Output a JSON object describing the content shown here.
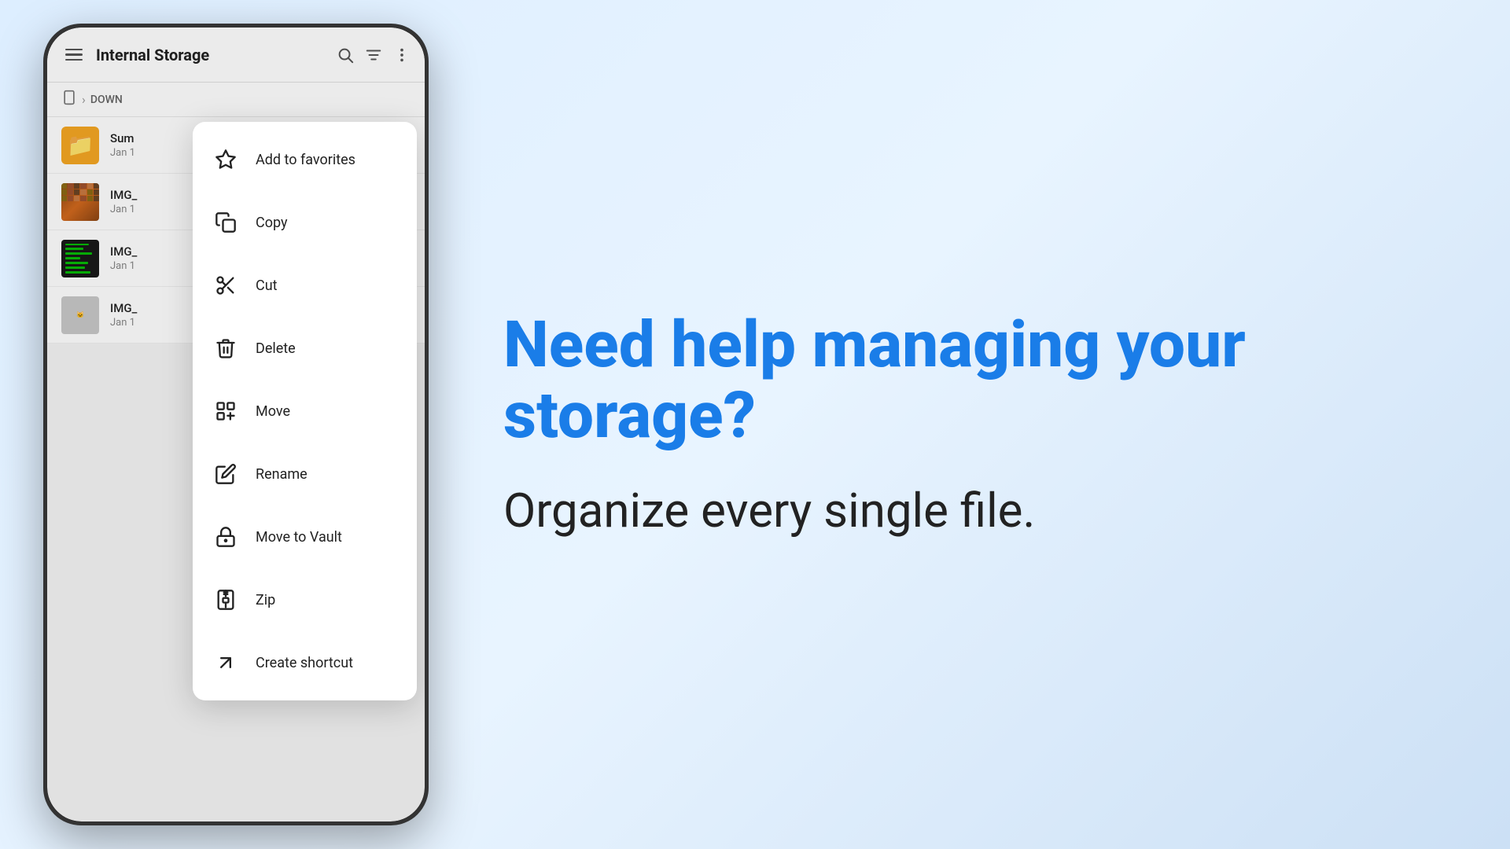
{
  "background": {
    "gradient_start": "#ddeeff",
    "gradient_end": "#cce0f5"
  },
  "right_content": {
    "headline": "Need help managing your storage?",
    "subheadline": "Organize every single file.",
    "accent_color": "#1a7de8"
  },
  "phone": {
    "header": {
      "title": "Internal Storage",
      "icons": [
        "search",
        "filter",
        "more"
      ]
    },
    "breadcrumb": {
      "icon": "tablet",
      "separator": ">",
      "path": "DOWN"
    },
    "files": [
      {
        "name": "Sum",
        "date": "Jan 1",
        "type": "folder"
      },
      {
        "name": "IMG_",
        "date": "Jan 1",
        "type": "image1"
      },
      {
        "name": "IMG_",
        "date": "Jan 1",
        "type": "image2"
      },
      {
        "name": "IMG_",
        "date": "Jan 1",
        "type": "image3"
      }
    ],
    "context_menu": {
      "items": [
        {
          "id": "add-favorites",
          "label": "Add to favorites",
          "icon": "star"
        },
        {
          "id": "copy",
          "label": "Copy",
          "icon": "copy"
        },
        {
          "id": "cut",
          "label": "Cut",
          "icon": "scissors"
        },
        {
          "id": "delete",
          "label": "Delete",
          "icon": "trash"
        },
        {
          "id": "move",
          "label": "Move",
          "icon": "move"
        },
        {
          "id": "rename",
          "label": "Rename",
          "icon": "edit"
        },
        {
          "id": "move-vault",
          "label": "Move to Vault",
          "icon": "lock"
        },
        {
          "id": "zip",
          "label": "Zip",
          "icon": "zip"
        },
        {
          "id": "create-shortcut",
          "label": "Create shortcut",
          "icon": "shortcut"
        }
      ]
    }
  }
}
